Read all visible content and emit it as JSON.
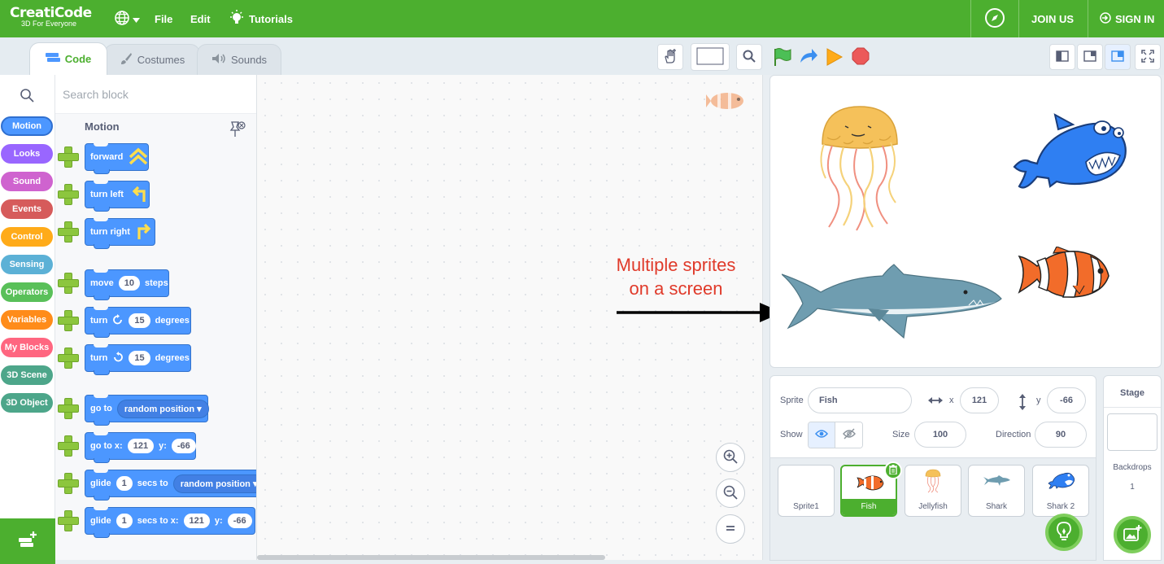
{
  "menubar": {
    "logo_title": "CreatiCode",
    "logo_subtitle": "3D For Everyone",
    "file": "File",
    "edit": "Edit",
    "tutorials": "Tutorials",
    "join": "JOIN US",
    "signin": "SIGN IN"
  },
  "tabs": {
    "code": "Code",
    "costumes": "Costumes",
    "sounds": "Sounds"
  },
  "search": {
    "placeholder": "Search block"
  },
  "categories": [
    {
      "label": "Motion",
      "color": "#4c97ff"
    },
    {
      "label": "Looks",
      "color": "#9966ff"
    },
    {
      "label": "Sound",
      "color": "#cf63cf"
    },
    {
      "label": "Events",
      "color": "#d65b5b"
    },
    {
      "label": "Control",
      "color": "#ffab19"
    },
    {
      "label": "Sensing",
      "color": "#5cb1d6"
    },
    {
      "label": "Operators",
      "color": "#59c059"
    },
    {
      "label": "Variables",
      "color": "#ff8c1a"
    },
    {
      "label": "My Blocks",
      "color": "#ff6680"
    },
    {
      "label": "3D Scene",
      "color": "#4da68a"
    },
    {
      "label": "3D Object",
      "color": "#4da68a"
    }
  ],
  "palette": {
    "title": "Motion",
    "forward": "forward",
    "turn_left": "turn left",
    "turn_right": "turn right",
    "move": "move",
    "move_val": "10",
    "steps": "steps",
    "turn": "turn",
    "turn_cw_val": "15",
    "turn_ccw_val": "15",
    "degrees": "degrees",
    "goto": "go to",
    "goto_dd": "random position",
    "gotoxy": "go to x:",
    "x_val": "121",
    "y_lbl": "y:",
    "y_val": "-66",
    "glide": "glide",
    "glide_secs": "1",
    "secs_to": "secs to",
    "glide_dd": "random position",
    "glide2_secs": "1",
    "secs_to_x": "secs to x:",
    "glide2_x": "121",
    "glide2_y_lbl": "y:",
    "glide2_y": "-66"
  },
  "annotation": {
    "line1": "Multiple sprites",
    "line2": "on a screen"
  },
  "sprite_info": {
    "sprite_label": "Sprite",
    "sprite_name": "Fish",
    "x_label": "x",
    "x": "121",
    "y_label": "y",
    "y": "-66",
    "show_label": "Show",
    "size_label": "Size",
    "size": "100",
    "direction_label": "Direction",
    "direction": "90"
  },
  "sprites": [
    "Sprite1",
    "Fish",
    "Jellyfish",
    "Shark",
    "Shark 2"
  ],
  "stage_panel": {
    "title": "Stage",
    "backdrops_label": "Backdrops",
    "backdrops_count": "1"
  }
}
